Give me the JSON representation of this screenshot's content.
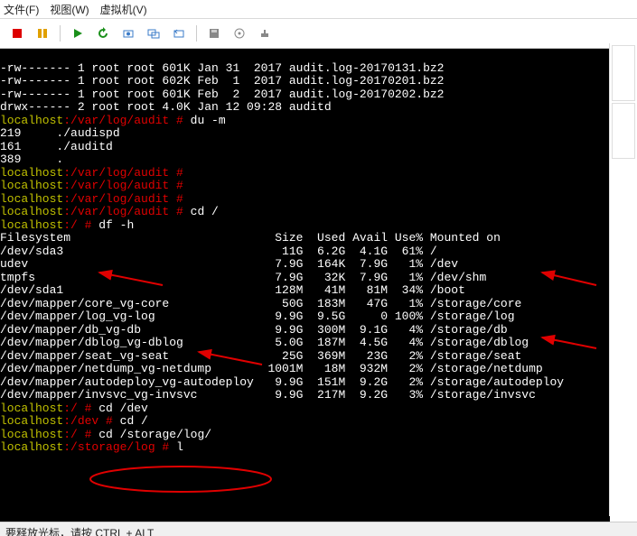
{
  "menu": {
    "file": "文件(F)",
    "view": "视图(W)",
    "vm": "虚拟机(V)"
  },
  "status": "要释放光标，请按 CTRL + ALT",
  "icons": {
    "stop": "stop",
    "pause": "pause",
    "play": "play",
    "reload": "reload",
    "snapshot": "snapshot",
    "snapmgr": "snapshot-manager",
    "floppy": "floppy",
    "cd": "cd",
    "printer": "printer",
    "sound": "sound",
    "net": "net"
  },
  "df_headers": [
    "Filesystem",
    "Size",
    "Used",
    "Avail",
    "Use%",
    "Mounted on"
  ],
  "df_rows": [
    [
      "/dev/sda3",
      "11G",
      "6.2G",
      "4.1G",
      "61%",
      "/"
    ],
    [
      "udev",
      "7.9G",
      "164K",
      "7.9G",
      "1%",
      "/dev"
    ],
    [
      "tmpfs",
      "7.9G",
      "32K",
      "7.9G",
      "1%",
      "/dev/shm"
    ],
    [
      "/dev/sda1",
      "128M",
      "41M",
      "81M",
      "34%",
      "/boot"
    ],
    [
      "/dev/mapper/core_vg-core",
      "50G",
      "183M",
      "47G",
      "1%",
      "/storage/core"
    ],
    [
      "/dev/mapper/log_vg-log",
      "9.9G",
      "9.5G",
      "0",
      "100%",
      "/storage/log"
    ],
    [
      "/dev/mapper/db_vg-db",
      "9.9G",
      "300M",
      "9.1G",
      "4%",
      "/storage/db"
    ],
    [
      "/dev/mapper/dblog_vg-dblog",
      "5.0G",
      "187M",
      "4.5G",
      "4%",
      "/storage/dblog"
    ],
    [
      "/dev/mapper/seat_vg-seat",
      "25G",
      "369M",
      "23G",
      "2%",
      "/storage/seat"
    ],
    [
      "/dev/mapper/netdump_vg-netdump",
      "1001M",
      "18M",
      "932M",
      "2%",
      "/storage/netdump"
    ],
    [
      "/dev/mapper/autodeploy_vg-autodeploy",
      "9.9G",
      "151M",
      "9.2G",
      "2%",
      "/storage/autodeploy"
    ],
    [
      "/dev/mapper/invsvc_vg-invsvc",
      "9.9G",
      "217M",
      "9.2G",
      "3%",
      "/storage/invsvc"
    ]
  ],
  "prompt_host": "localhost",
  "ls_lines": [
    "-rw------- 1 root root 601K Jan 31  2017 audit.log-20170131.bz2",
    "-rw------- 1 root root 602K Feb  1  2017 audit.log-20170201.bz2",
    "-rw------- 1 root root 601K Feb  2  2017 audit.log-20170202.bz2",
    "drwx------ 2 root root 4.0K Jan 12 09:28 auditd"
  ],
  "du_lines": [
    "219     ./audispd",
    "161     ./auditd",
    "389     ."
  ],
  "commands": {
    "du": "du -m",
    "cd_root": "cd /",
    "df": "df -h",
    "cd_dev": "cd /dev",
    "cd_root2": "cd /",
    "cd_storage": "cd /storage/log/",
    "l": "l"
  }
}
